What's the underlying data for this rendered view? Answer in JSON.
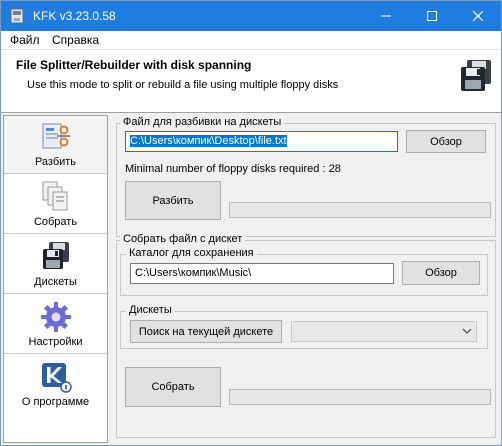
{
  "window": {
    "title": "KFK v3.23.0.58"
  },
  "menu": {
    "file": "Файл",
    "help": "Справка"
  },
  "header": {
    "title": "File Splitter/Rebuilder with disk spanning",
    "subtitle": "Use this mode to split or rebuild a file using multiple floppy disks"
  },
  "nav": {
    "items": [
      {
        "label": "Разбить",
        "icon": "split-icon"
      },
      {
        "label": "Собрать",
        "icon": "merge-icon"
      },
      {
        "label": "Дискеты",
        "icon": "floppy-icon"
      },
      {
        "label": "Настройки",
        "icon": "settings-gear-icon"
      },
      {
        "label": "О программе",
        "icon": "about-icon"
      }
    ]
  },
  "split": {
    "group_title": "Файл для разбивки на дискеты",
    "file_path": "C:\\Users\\компик\\Desktop\\file.txt",
    "browse_label": "Обзор",
    "info": "Minimal number of floppy disks required : 28",
    "split_button": "Разбить",
    "progress": 0
  },
  "merge": {
    "group_title": "Собрать файл с дискет",
    "save_group_title": "Каталог для сохранения",
    "save_path": "C:\\Users\\компик\\Music\\",
    "browse_label": "Обзор",
    "disks_group_title": "Дискеты",
    "search_button": "Поиск на текущей дискете",
    "disk_select_value": "",
    "merge_button": "Собрать",
    "progress": 0
  },
  "colors": {
    "titlebar": "#1f7de2",
    "selection": "#0078d7"
  }
}
